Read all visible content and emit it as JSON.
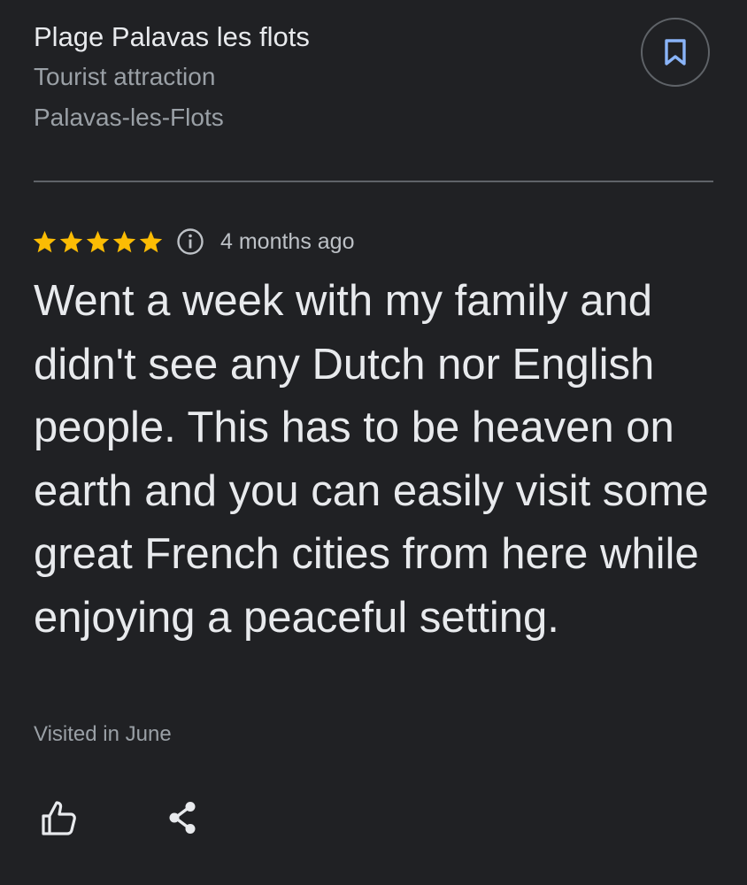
{
  "place": {
    "name": "Plage Palavas les flots",
    "category": "Tourist attraction",
    "locality": "Palavas-les-Flots"
  },
  "save_button": {
    "icon": "bookmark-icon"
  },
  "review": {
    "rating": 5,
    "rating_max": 5,
    "star_color": "#fbbc04",
    "info_icon": "info-icon",
    "date": "4 months ago",
    "text": "Went a week with my family and didn't see any Dutch nor English people. This has to be heaven on earth and you can easily visit some great French cities from here while enjoying a peaceful setting.",
    "visited": "Visited in June"
  },
  "actions": {
    "like_icon": "thumb-up-icon",
    "share_icon": "share-icon"
  },
  "colors": {
    "background": "#202124",
    "primary_text": "#e8eaed",
    "secondary_text": "#9aa0a6",
    "accent": "#8ab4f8",
    "divider": "#5f6368"
  }
}
